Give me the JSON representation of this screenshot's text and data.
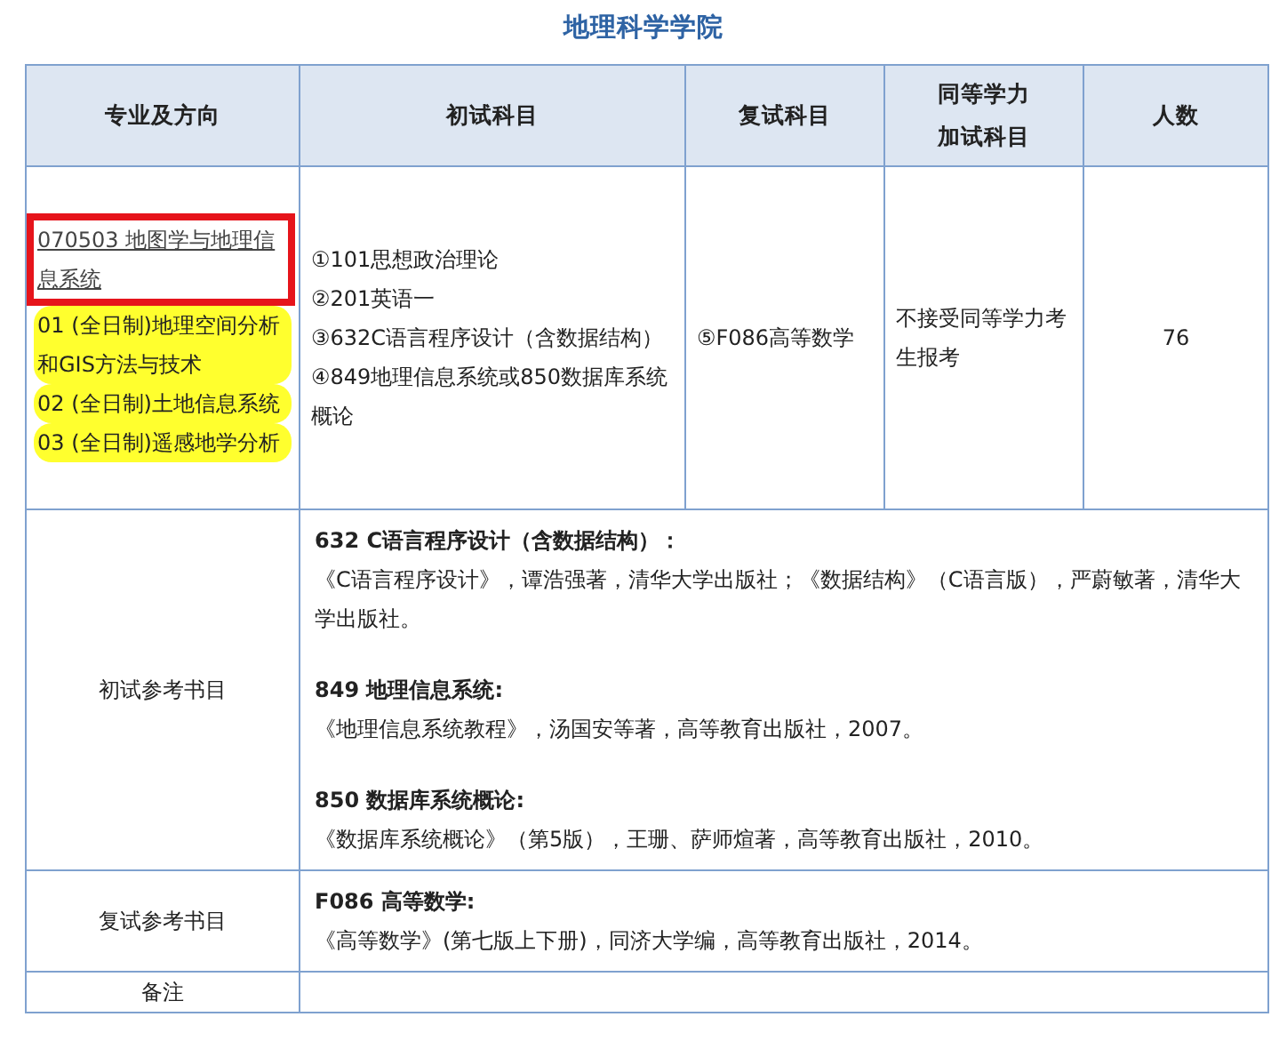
{
  "title": "地理科学学院",
  "columns": [
    {
      "lines": [
        "专业及方向"
      ]
    },
    {
      "lines": [
        "初试科目"
      ]
    },
    {
      "lines": [
        "复试科目"
      ]
    },
    {
      "lines": [
        "同等学力",
        "加试科目"
      ]
    },
    {
      "lines": [
        "人数"
      ]
    }
  ],
  "major": {
    "code_name": "070503 地图学与地理信息系统",
    "boxed": true,
    "directions": [
      {
        "text": "01 (全日制)地理空间分析和GIS方法与技术",
        "highlighted": true
      },
      {
        "text": "02 (全日制)土地信息系统",
        "highlighted": true
      },
      {
        "text": "03 (全日制)遥感地学分析",
        "highlighted": true
      }
    ]
  },
  "initial_subjects": [
    "①101思想政治理论",
    "②201英语一",
    "③632C语言程序设计（含数据结构）",
    "④849地理信息系统或850数据库系统概论"
  ],
  "retest_subject": "⑤F086高等数学",
  "equivalent": "不接受同等学力考生报考",
  "count": "76",
  "sections": [
    {
      "label": "初试参考书目",
      "books": [
        {
          "heading": "632 C语言程序设计（含数据结构）：",
          "text": "《C语言程序设计》，谭浩强著，清华大学出版社；《数据结构》（C语言版），严蔚敏著，清华大学出版社。"
        },
        {
          "heading": "849 地理信息系统:",
          "text": "《地理信息系统教程》，汤国安等著，高等教育出版社，2007。"
        },
        {
          "heading": "850 数据库系统概论:",
          "text": "《数据库系统概论》（第5版），王珊、萨师煊著，高等教育出版社，2010。"
        }
      ]
    },
    {
      "label": "复试参考书目",
      "books": [
        {
          "heading": "F086 高等数学:",
          "text": "《高等数学》(第七版上下册)，同济大学编，高等教育出版社，2014。"
        }
      ]
    },
    {
      "label": "备注"
    }
  ]
}
